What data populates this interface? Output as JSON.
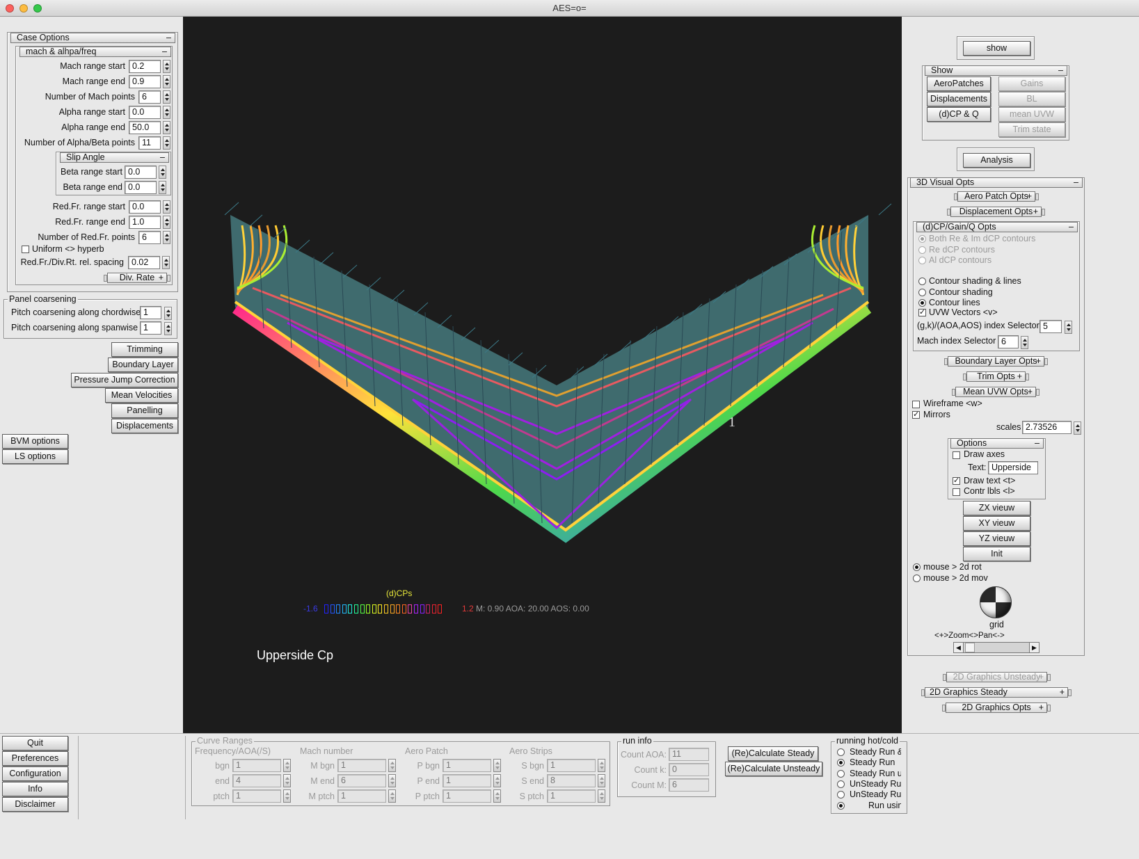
{
  "window": {
    "title": "AES=o="
  },
  "case_options": {
    "header": "Case Options",
    "mach_group": "mach & alhpa/freq",
    "fields": [
      {
        "label": "Mach range start",
        "value": "0.2"
      },
      {
        "label": "Mach range end",
        "value": "0.9"
      },
      {
        "label": "Number of Mach points",
        "value": "6"
      },
      {
        "label": "Alpha range start",
        "value": "0.0"
      },
      {
        "label": "Alpha range end",
        "value": "50.0"
      },
      {
        "label": "Number of Alpha/Beta points",
        "value": "11"
      }
    ],
    "slip_group": "Slip Angle",
    "slip_fields": [
      {
        "label": "Beta range start",
        "value": "0.0"
      },
      {
        "label": "Beta range end",
        "value": "0.0"
      }
    ],
    "redfr_fields": [
      {
        "label": "Red.Fr. range start",
        "value": "0.0"
      },
      {
        "label": "Red.Fr. range end",
        "value": "1.0"
      },
      {
        "label": "Number of Red.Fr. points",
        "value": "6"
      }
    ],
    "uniform_label": "Uniform <> hyperb",
    "uniform_checked": false,
    "spacing_label": "Red.Fr./Div.Rt. rel. spacing",
    "spacing_value": "0.02",
    "div_rate": "Div. Rate"
  },
  "panel_coarsening": {
    "header": "Panel coarsening",
    "chord_label": "Pitch coarsening along chordwise",
    "chord_value": "1",
    "span_label": "Pitch coarsening along  spanwise",
    "span_value": "1"
  },
  "left_buttons": [
    "Trimming",
    "Boundary Layer",
    "Pressure Jump Correction",
    "Mean Velocities",
    "Panelling",
    "Displacements"
  ],
  "method_buttons": [
    "BVM options",
    "LS  options"
  ],
  "bottom_left_buttons": [
    "Quit",
    "Preferences",
    "Configuration",
    "Info",
    "Disclaimer"
  ],
  "curve_ranges": {
    "header": "Curve Ranges",
    "columns": [
      {
        "title": "Frequency/AOA(/S)",
        "rows": [
          {
            "label": "bgn",
            "value": "1"
          },
          {
            "label": "end",
            "value": "4"
          },
          {
            "label": "ptch",
            "value": "1"
          }
        ]
      },
      {
        "title": "Mach number",
        "rows": [
          {
            "label": "M bgn",
            "value": "1"
          },
          {
            "label": "M end",
            "value": "6"
          },
          {
            "label": "M ptch",
            "value": "1"
          }
        ]
      },
      {
        "title": "Aero Patch",
        "rows": [
          {
            "label": "P bgn",
            "value": "1"
          },
          {
            "label": "P end",
            "value": "1"
          },
          {
            "label": "P ptch",
            "value": "1"
          }
        ]
      },
      {
        "title": "Aero Strips",
        "rows": [
          {
            "label": "S bgn",
            "value": "1"
          },
          {
            "label": "S end",
            "value": "8"
          },
          {
            "label": "S ptch",
            "value": "1"
          }
        ]
      }
    ]
  },
  "run_info": {
    "header": "run info",
    "rows": [
      {
        "label": "Count AOA:",
        "value": "11"
      },
      {
        "label": "Count k:",
        "value": "0"
      },
      {
        "label": "Count M:",
        "value": "6"
      }
    ]
  },
  "calc_buttons": [
    "(Re)Calculate Steady",
    "(Re)Calculate Unsteady"
  ],
  "running": {
    "header": "running hot/cold",
    "options": [
      {
        "label": "Steady Run &",
        "on": false
      },
      {
        "label": "Steady Run",
        "on": true
      },
      {
        "label": "Steady Run  u",
        "on": false
      },
      {
        "label": "UnSteady Run",
        "on": false
      },
      {
        "label": "UnSteady Run",
        "on": false
      },
      {
        "label": "Run  usin",
        "on": true
      }
    ]
  },
  "right_panel": {
    "show_button": "show",
    "show_group": "Show",
    "show_left": [
      "AeroPatches",
      "Displacements",
      "(d)CP & Q"
    ],
    "show_right": [
      "Gains",
      "BL",
      "mean UVW",
      "Trim state"
    ],
    "analysis_button": "Analysis",
    "visual_header": "3D Visual Opts",
    "aero_patch_opts": "Aero Patch Opts",
    "displacement_opts": "Displacement  Opts",
    "dcp_header": "(d)CP/Gain/Q  Opts",
    "dcp_radios": [
      {
        "label": "Both Re & Im dCP contours",
        "on": true
      },
      {
        "label": "Re dCP contours",
        "on": false
      },
      {
        "label": "Al dCP contours",
        "on": false
      }
    ],
    "contour_radios": [
      {
        "label": "Contour shading & lines",
        "on": false
      },
      {
        "label": "Contour shading",
        "on": false
      },
      {
        "label": "Contour lines",
        "on": true
      }
    ],
    "uvw_label": "UVW Vectors <v>",
    "uvw_checked": true,
    "index_label": "(g,k)/(AOA,AOS) index Selector",
    "index_value": "5",
    "mach_index_label": "Mach index Selector",
    "mach_index_value": "6",
    "bl_opts": "Boundary Layer Opts",
    "trim_opts": "Trim  Opts",
    "mean_uvw_opts": "Mean UVW Opts",
    "wireframe_label": "Wireframe <w>",
    "wireframe_checked": false,
    "mirrors_label": "Mirrors",
    "mirrors_checked": true,
    "scales_label": "scales",
    "scales_value": "2.73526",
    "options_header": "Options",
    "draw_axes_label": "Draw axes",
    "draw_axes_checked": false,
    "text_label": "Text:",
    "text_value": "Upperside",
    "draw_text_label": "Draw  text <t>",
    "draw_text_checked": true,
    "contr_lbls_label": "Contr lbls <l>",
    "contr_lbls_checked": false,
    "view_buttons": [
      "ZX vieuw",
      "XY vieuw",
      "YZ vieuw",
      "Init"
    ],
    "mouse_radios": [
      {
        "label": "mouse > 2d rot",
        "on": true
      },
      {
        "label": "mouse > 2d mov",
        "on": false
      }
    ],
    "grid_label": "grid",
    "zoom_label": "<+>Zoom<>Pan<->",
    "graphics_unsteady": "2D Graphics Unsteady",
    "graphics_steady": "2D Graphics Steady",
    "graphics_opts": "2D Graphics Opts"
  },
  "viewport": {
    "legend_title": "(d)CPs",
    "legend_min": "-1.6",
    "legend_max": "1.2",
    "legend_info": "M: 0.90 AOA:  20.00 AOS:   0.00",
    "caption": "Upperside Cp",
    "marker": "1",
    "colors": {
      "background": "#1c1c1c",
      "surface": "#3f6b6e",
      "legend_title": "#e8e83a",
      "legend_min": "#3a3ae6",
      "legend_max": "#e63a3a"
    }
  }
}
